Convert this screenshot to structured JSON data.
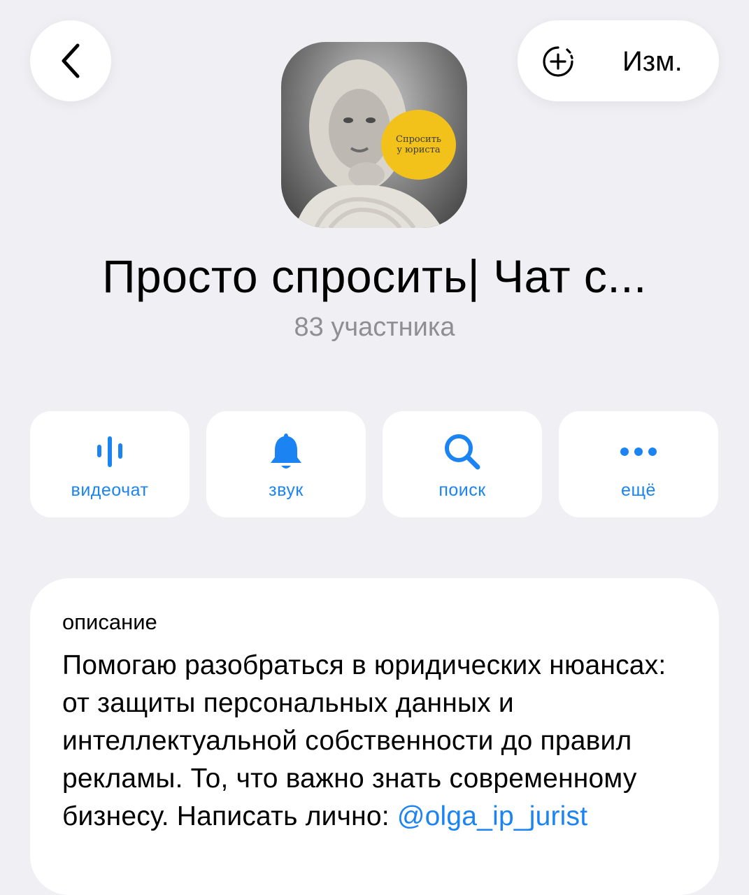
{
  "header": {
    "edit_label": "Изм."
  },
  "avatar": {
    "badge_line1": "Спросить",
    "badge_line2": "у юриста"
  },
  "chat": {
    "title": "Просто спросить| Чат с...",
    "members": "83 участника"
  },
  "actions": [
    {
      "label": "видеочат",
      "icon": "voice-chat-icon"
    },
    {
      "label": "звук",
      "icon": "bell-icon"
    },
    {
      "label": "поиск",
      "icon": "search-icon"
    },
    {
      "label": "ещё",
      "icon": "more-dots-icon"
    }
  ],
  "description": {
    "heading": "описание",
    "text": "Помогаю разобраться в юридических нюансах: от защиты персональных данных и интеллектуальной собственности до правил рекламы. То, что важно знать современному бизнесу. Написать лично: ",
    "link": "@olga_ip_jurist"
  },
  "colors": {
    "accent": "#1b84f2",
    "background": "#efeff4",
    "secondary_text": "#8e8e93",
    "badge": "#f2c21b"
  }
}
